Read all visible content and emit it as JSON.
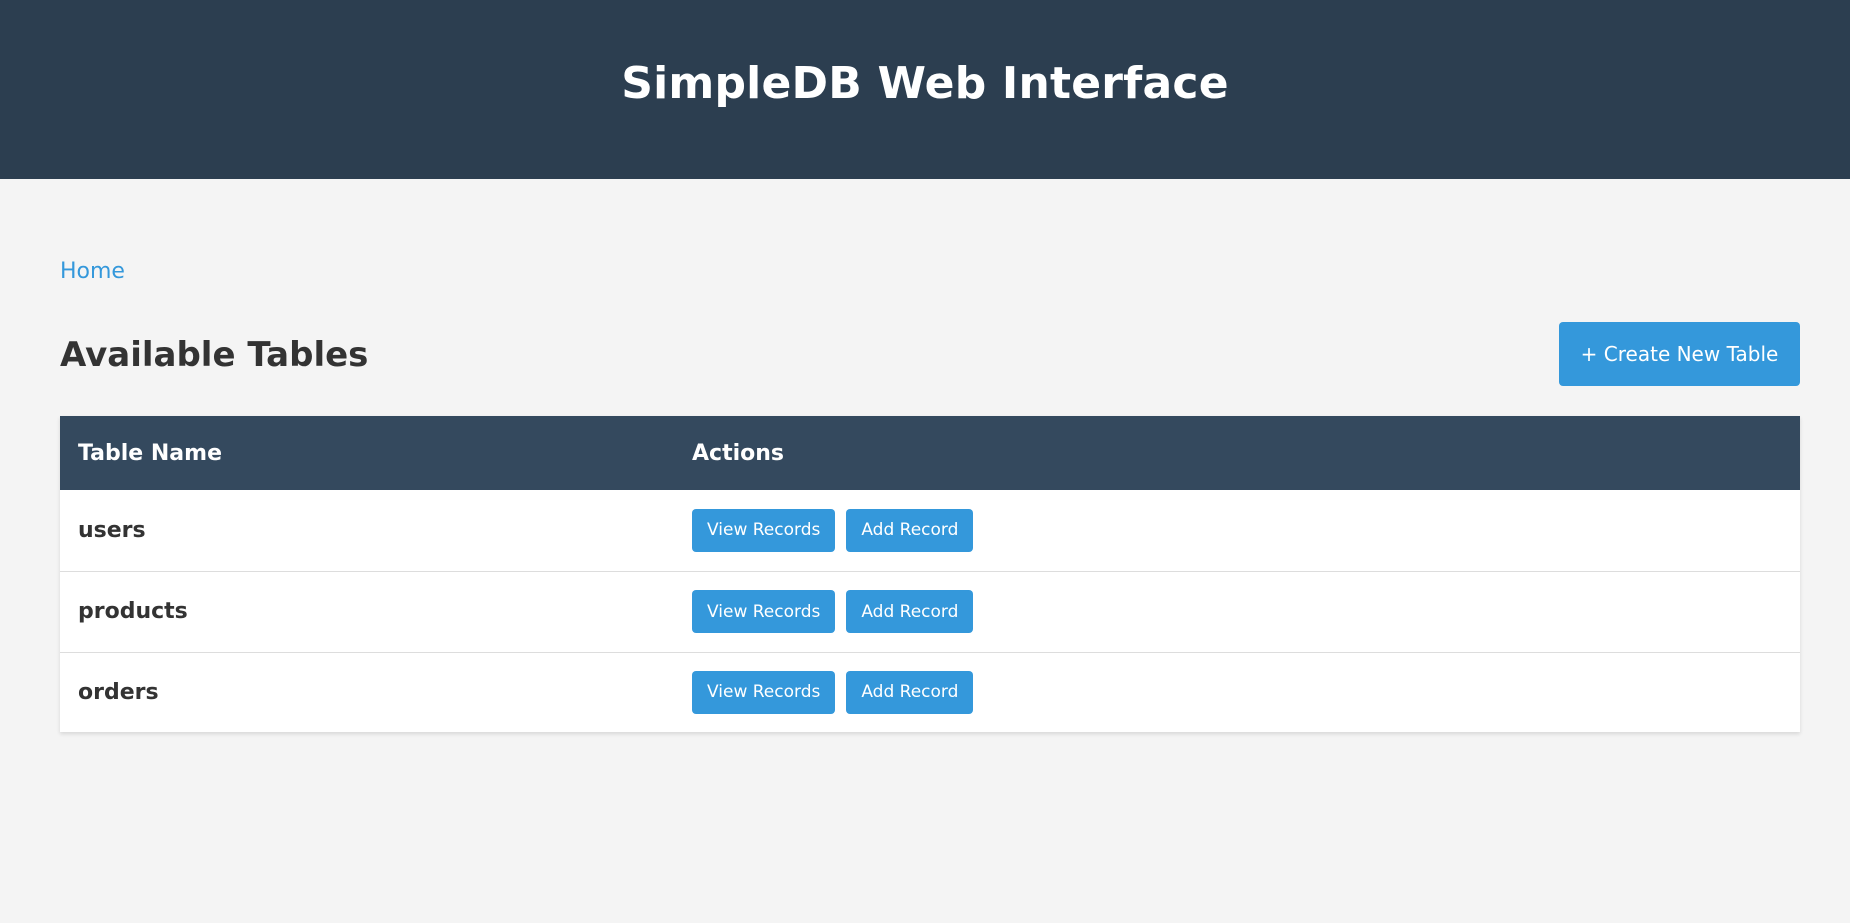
{
  "header": {
    "title": "SimpleDB Web Interface"
  },
  "breadcrumb": {
    "home": "Home"
  },
  "section": {
    "title": "Available Tables",
    "create_button": "+ Create New Table"
  },
  "table": {
    "columns": [
      "Table Name",
      "Actions"
    ],
    "rows": [
      {
        "name": "users",
        "view_label": "View Records",
        "add_label": "Add Record"
      },
      {
        "name": "products",
        "view_label": "View Records",
        "add_label": "Add Record"
      },
      {
        "name": "orders",
        "view_label": "View Records",
        "add_label": "Add Record"
      }
    ]
  },
  "colors": {
    "header_bg": "#2c3e50",
    "table_header_bg": "#34495e",
    "accent": "#3498db",
    "page_bg": "#f4f4f4"
  }
}
